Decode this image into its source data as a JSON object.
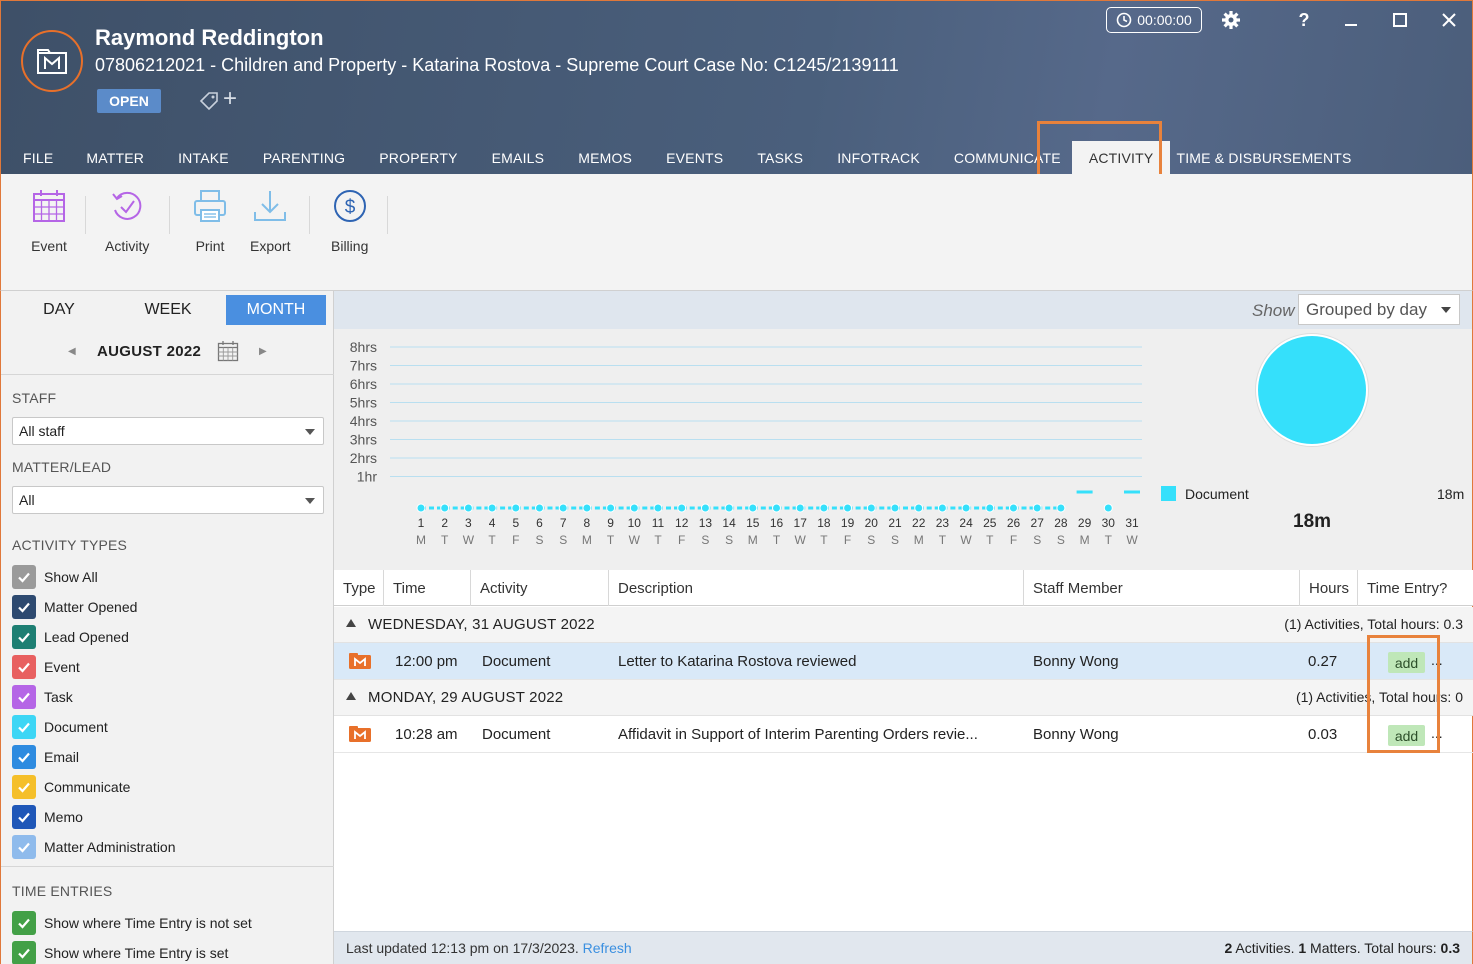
{
  "header": {
    "client_name": "Raymond Reddington",
    "matter_line": "07806212021 - Children and Property - Katarina Rostova - Supreme Court Case No: C1245/2139111",
    "status": "OPEN",
    "timer": "00:00:00",
    "tag_add": "+"
  },
  "tabs": [
    {
      "label": "FILE"
    },
    {
      "label": "MATTER"
    },
    {
      "label": "INTAKE"
    },
    {
      "label": "PARENTING"
    },
    {
      "label": "PROPERTY"
    },
    {
      "label": "EMAILS"
    },
    {
      "label": "MEMOS"
    },
    {
      "label": "EVENTS"
    },
    {
      "label": "TASKS"
    },
    {
      "label": "INFOTRACK"
    },
    {
      "label": "COMMUNICATE"
    },
    {
      "label": "ACTIVITY"
    },
    {
      "label": "TIME & DISBURSEMENTS"
    }
  ],
  "active_tab": "ACTIVITY",
  "toolbar": {
    "event": "Event",
    "activity": "Activity",
    "print": "Print",
    "export": "Export",
    "billing": "Billing"
  },
  "sidebar": {
    "range_tabs": [
      "DAY",
      "WEEK",
      "MONTH"
    ],
    "active_range": "MONTH",
    "month_label": "AUGUST 2022",
    "staff_heading": "STAFF",
    "staff_value": "All staff",
    "matter_heading": "MATTER/LEAD",
    "matter_value": "All",
    "activity_types_heading": "ACTIVITY TYPES",
    "activity_types": [
      {
        "label": "Show All",
        "color": "#9a9a9a"
      },
      {
        "label": "Matter Opened",
        "color": "#2e4a70"
      },
      {
        "label": "Lead Opened",
        "color": "#1e7f73"
      },
      {
        "label": "Event",
        "color": "#e86060"
      },
      {
        "label": "Task",
        "color": "#b565e6"
      },
      {
        "label": "Document",
        "color": "#3dd6f5"
      },
      {
        "label": "Email",
        "color": "#2e8be0"
      },
      {
        "label": "Communicate",
        "color": "#f5bf2a"
      },
      {
        "label": "Memo",
        "color": "#1f57b8"
      },
      {
        "label": "Matter Administration",
        "color": "#8fbbec"
      }
    ],
    "time_entries_heading": "TIME ENTRIES",
    "time_entries": [
      {
        "label": "Show where Time Entry is not set",
        "color": "#43a047"
      },
      {
        "label": "Show where Time Entry is set",
        "color": "#43a047"
      }
    ]
  },
  "show_bar": {
    "show_label": "Show",
    "group_value": "Grouped by day"
  },
  "chart_data": {
    "type": "line",
    "y_tick_labels": [
      "8hrs",
      "7hrs",
      "6hrs",
      "5hrs",
      "4hrs",
      "3hrs",
      "2hrs",
      "1hr"
    ],
    "ylim": [
      0,
      8
    ],
    "x": [
      1,
      2,
      3,
      4,
      5,
      6,
      7,
      8,
      9,
      10,
      11,
      12,
      13,
      14,
      15,
      16,
      17,
      18,
      19,
      20,
      21,
      22,
      23,
      24,
      25,
      26,
      27,
      28,
      29,
      30,
      31
    ],
    "weekday_labels": [
      "M",
      "T",
      "W",
      "T",
      "F",
      "S",
      "S",
      "M",
      "T",
      "W",
      "T",
      "F",
      "S",
      "S",
      "M",
      "T",
      "W",
      "T",
      "F",
      "S",
      "S",
      "M",
      "T",
      "W",
      "T",
      "F",
      "S",
      "S",
      "M",
      "T",
      "W"
    ],
    "series": [
      {
        "name": "Document",
        "color": "#35e0fb",
        "values": [
          0,
          0,
          0,
          0,
          0,
          0,
          0,
          0,
          0,
          0,
          0,
          0,
          0,
          0,
          0,
          0,
          0,
          0,
          0,
          0,
          0,
          0,
          0,
          0,
          0,
          0,
          0,
          0,
          0.03,
          0,
          0.27
        ]
      }
    ],
    "pie": {
      "legend": [
        {
          "label": "Document",
          "value": "18m",
          "color": "#35e0fb"
        }
      ],
      "total": "18m"
    }
  },
  "table": {
    "columns": [
      "Type",
      "Time",
      "Activity",
      "Description",
      "Staff Member",
      "Hours",
      "Time Entry?"
    ],
    "groups": [
      {
        "title": "WEDNESDAY, 31 AUGUST 2022",
        "summary": "(1) Activities, Total hours: 0.3",
        "rows": [
          {
            "time": "12:00 pm",
            "activity": "Document",
            "description": "Letter to Katarina Rostova reviewed",
            "staff": "Bonny Wong",
            "hours": "0.27",
            "time_entry": "add",
            "more": "..."
          }
        ]
      },
      {
        "title": "MONDAY, 29 AUGUST 2022",
        "summary": "(1) Activities, Total hours: 0",
        "rows": [
          {
            "time": "10:28 am",
            "activity": "Document",
            "description": "Affidavit in Support of Interim Parenting Orders revie...",
            "staff": "Bonny Wong",
            "hours": "0.03",
            "time_entry": "add",
            "more": "..."
          }
        ]
      }
    ]
  },
  "status_bar": {
    "last_updated": "Last updated 12:13 pm on 17/3/2023.",
    "refresh": "Refresh",
    "activities_count": "2",
    "activities_label": " Activities. ",
    "matters_count": "1",
    "matters_label": " Matters. Total hours: ",
    "total_hours": "0.3"
  }
}
